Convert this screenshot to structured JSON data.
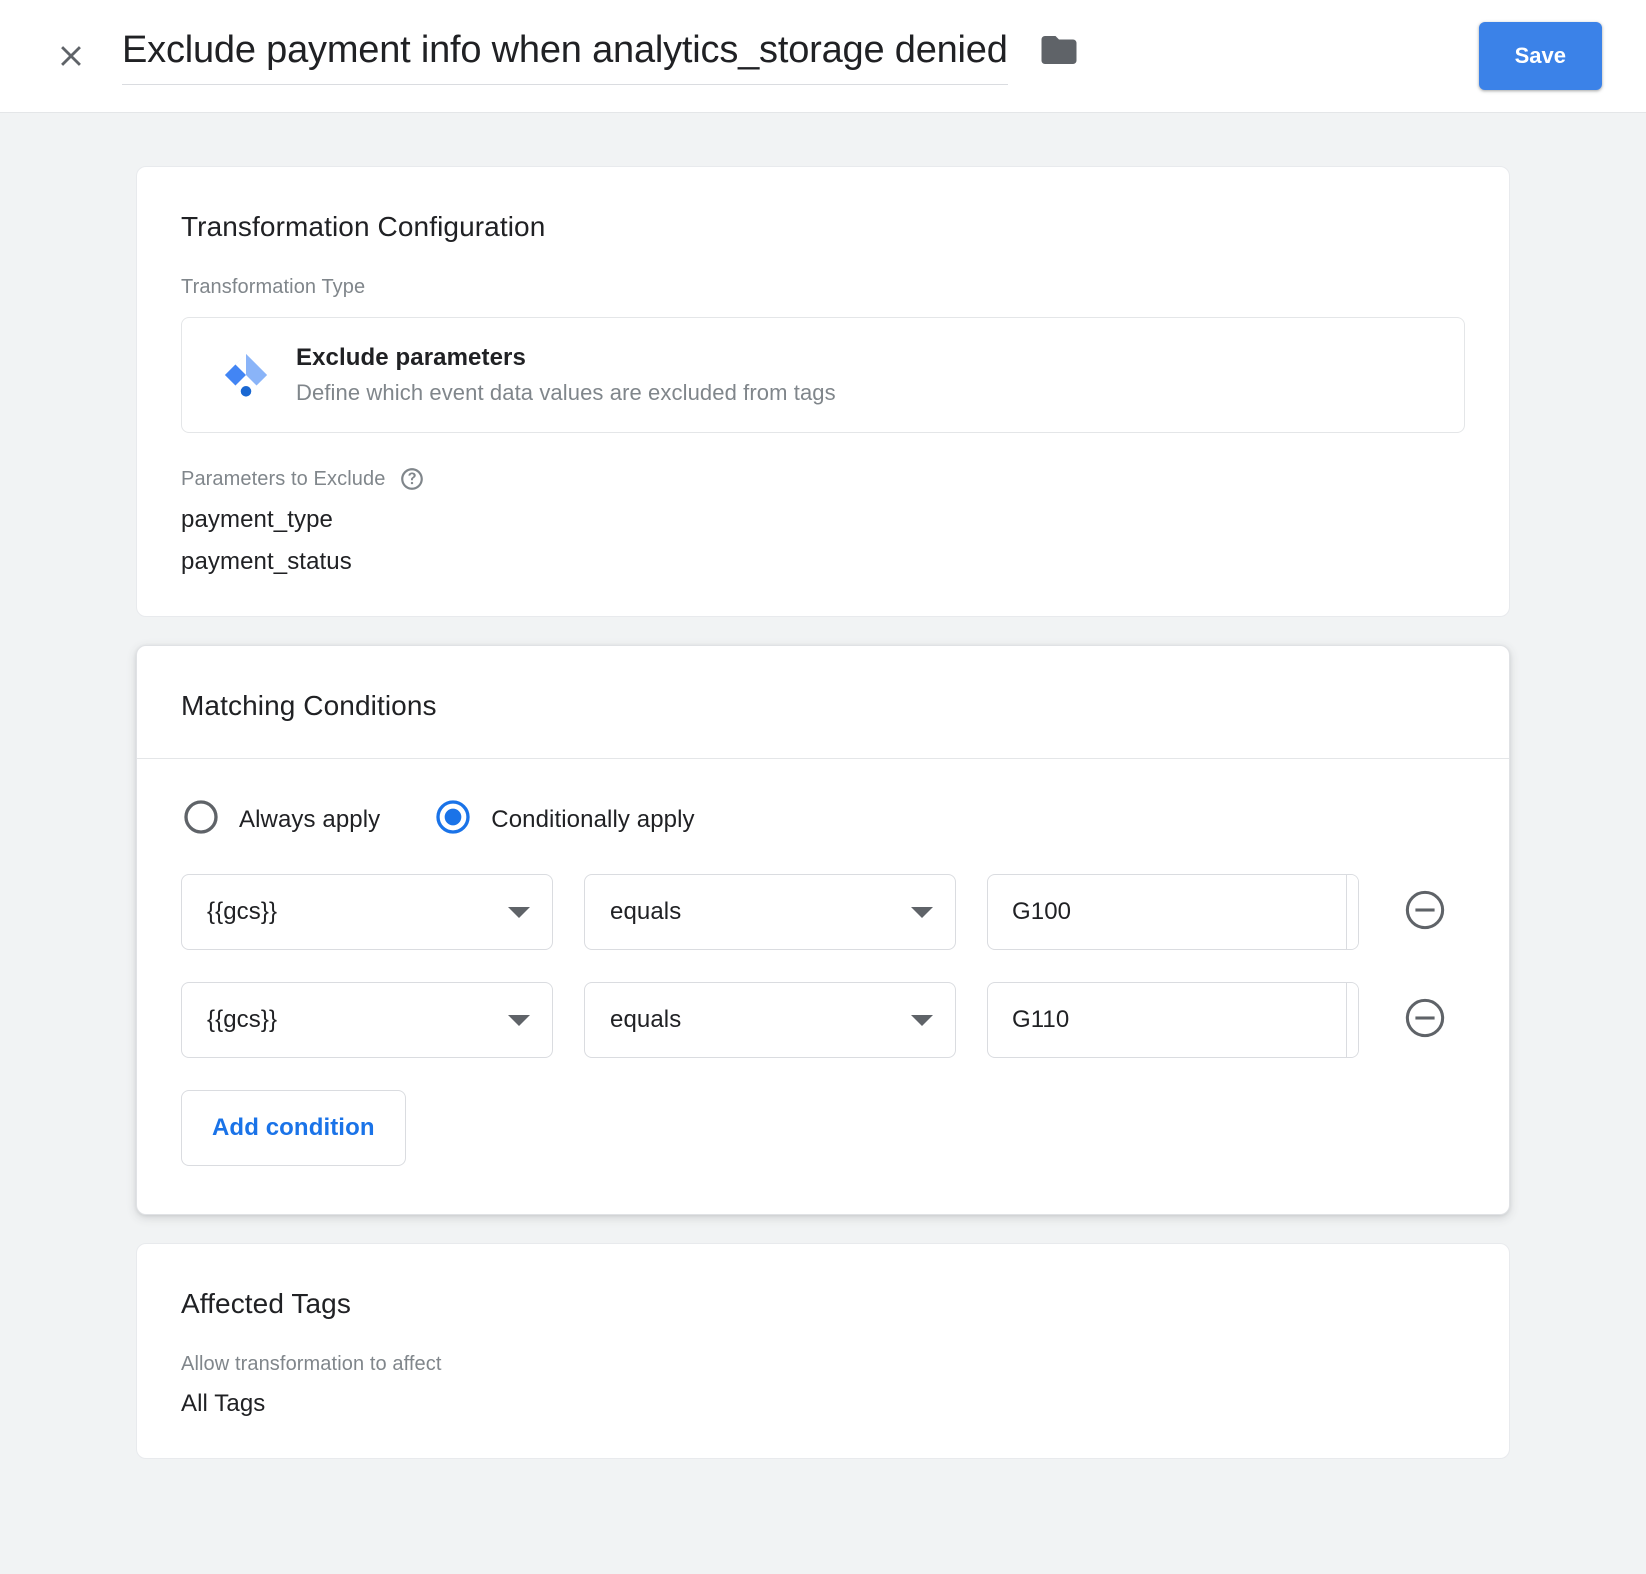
{
  "header": {
    "close_icon": "close-icon",
    "title": "Exclude payment info when analytics_storage denied",
    "folder_icon": "folder-icon",
    "save_label": "Save",
    "accent_color": "#3b82e8"
  },
  "transformation_card": {
    "title": "Transformation Configuration",
    "type_label": "Transformation Type",
    "type": {
      "icon": "gtm-diamond-icon",
      "name": "Exclude parameters",
      "description": "Define which event data values are excluded from tags"
    },
    "parameters_label": "Parameters to Exclude",
    "parameters_help_icon": "help-icon",
    "parameters": [
      "payment_type",
      "payment_status"
    ]
  },
  "matching_card": {
    "title": "Matching Conditions",
    "radio_options": [
      {
        "label": "Always apply",
        "selected": false
      },
      {
        "label": "Conditionally apply",
        "selected": true
      }
    ],
    "conditions": [
      {
        "variable": "{{gcs}}",
        "operator": "equals",
        "value": "G100",
        "brick_icon": "insert-variable-icon",
        "remove_icon": "remove-circle-icon"
      },
      {
        "variable": "{{gcs}}",
        "operator": "equals",
        "value": "G110",
        "brick_icon": "insert-variable-icon",
        "remove_icon": "remove-circle-icon"
      }
    ],
    "add_condition_label": "Add condition",
    "selected_radio_color": "#1a73e8"
  },
  "affected_card": {
    "title": "Affected Tags",
    "allow_label": "Allow transformation to affect",
    "allow_value": "All Tags"
  }
}
